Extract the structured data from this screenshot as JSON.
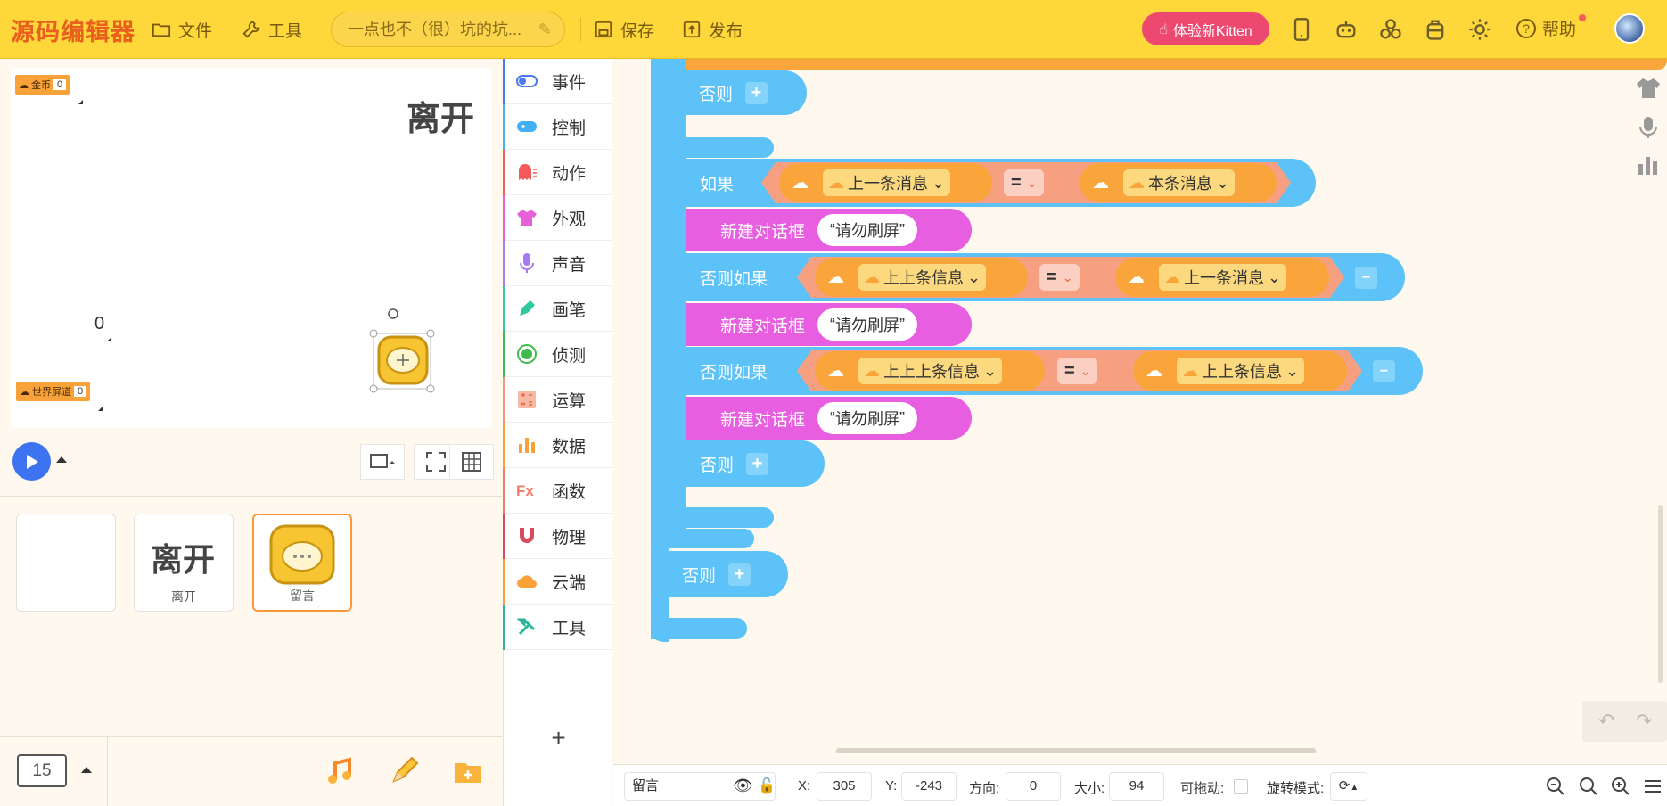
{
  "header": {
    "logo": "源码编辑器",
    "menu_file": "文件",
    "menu_tools": "工具",
    "project_name": "一点也不（很）坑的坑...",
    "save_label": "保存",
    "publish_label": "发布",
    "kitten_label": "体验新Kitten",
    "help_label": "帮助"
  },
  "stage": {
    "monitor_coins_label": "金币",
    "monitor_coins_value": "0",
    "monitor_spam_label": "世界屏道",
    "monitor_spam_value": "0",
    "leave_text": "离开",
    "zero_text": "0"
  },
  "sprites": [
    {
      "name": ""
    },
    {
      "name": "离开"
    },
    {
      "name": "留言"
    }
  ],
  "fps": "15",
  "categories": [
    {
      "label": "事件",
      "color": "#4a7af4"
    },
    {
      "label": "控制",
      "color": "#43b0f5"
    },
    {
      "label": "动作",
      "color": "#f45a5a"
    },
    {
      "label": "外观",
      "color": "#e760d8"
    },
    {
      "label": "声音",
      "color": "#a77af0"
    },
    {
      "label": "画笔",
      "color": "#2ec9a0"
    },
    {
      "label": "侦测",
      "color": "#3dbb4c"
    },
    {
      "label": "运算",
      "color": "#f5977a"
    },
    {
      "label": "数据",
      "color": "#f9a23a"
    },
    {
      "label": "函数",
      "color": "#f27d6a"
    },
    {
      "label": "物理",
      "color": "#d74b5a"
    },
    {
      "label": "云端",
      "color": "#f9a23a"
    },
    {
      "label": "工具",
      "color": "#2cb59c"
    }
  ],
  "blocks": {
    "else1": "否则",
    "if": "如果",
    "var_prev": "上一条消息",
    "var_cur": "本条消息",
    "var_prev2": "上上条信息",
    "var_prev3": "上上上条信息",
    "eq": "=",
    "dialog": "新建对话框",
    "msg": "请勿刷屏",
    "elseif": "否则如果",
    "else2": "否则",
    "else3": "否则"
  },
  "status": {
    "sprite_name": "留言",
    "x_label": "X:",
    "x_value": "305",
    "y_label": "Y:",
    "y_value": "-243",
    "dir_label": "方向:",
    "dir_value": "0",
    "size_label": "大小:",
    "size_value": "94",
    "drag_label": "可拖动:",
    "rot_label": "旋转模式:"
  }
}
